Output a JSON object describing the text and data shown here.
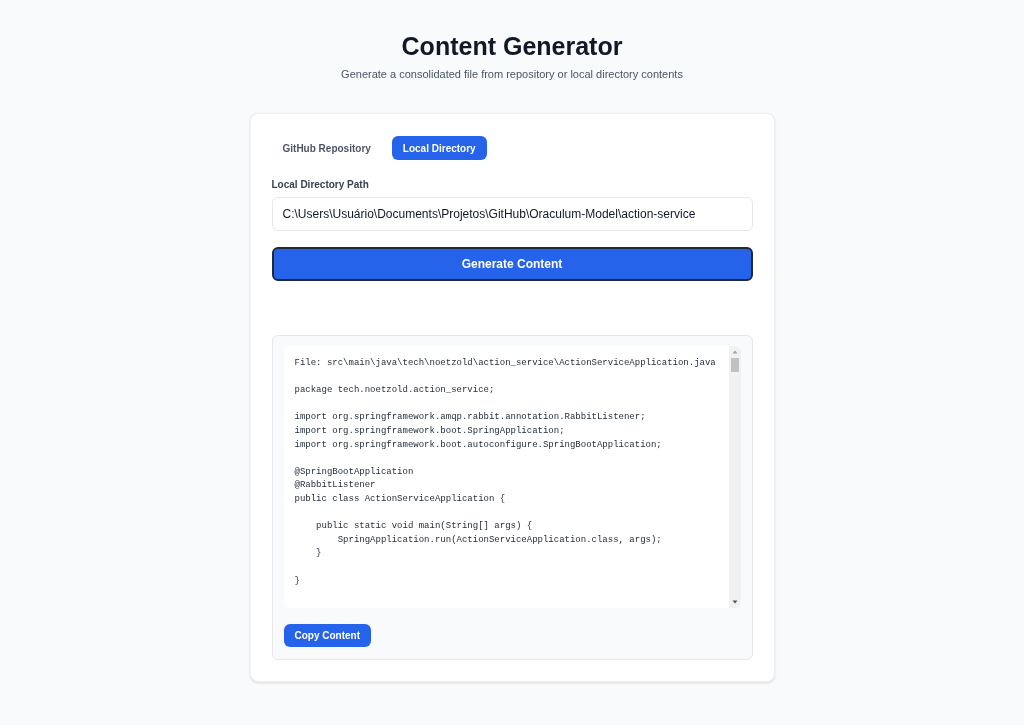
{
  "header": {
    "title": "Content Generator",
    "subtitle": "Generate a consolidated file from repository or local directory contents"
  },
  "tabs": [
    {
      "label": "GitHub Repository",
      "selected": false
    },
    {
      "label": "Local Directory",
      "selected": true
    }
  ],
  "path_field": {
    "label": "Local Directory Path",
    "value": "C:\\Users\\Usuário\\Documents\\Projetos\\GitHub\\Oraculum-Model\\action-service"
  },
  "generate_button": "Generate Content",
  "output": {
    "code_blocks": [
      [
        "File: src\\main\\java\\tech\\noetzold\\action_service\\ActionServiceApplication.java"
      ],
      [
        "package tech.noetzold.action_service;"
      ],
      [
        "import org.springframework.amqp.rabbit.annotation.RabbitListener;",
        "import org.springframework.boot.SpringApplication;",
        "import org.springframework.boot.autoconfigure.SpringBootApplication;"
      ],
      [
        "@SpringBootApplication",
        "@RabbitListener",
        "public class ActionServiceApplication {"
      ],
      [
        "    public static void main(String[] args) {",
        "        SpringApplication.run(ActionServiceApplication.class, args);",
        "    }"
      ],
      [
        "}"
      ]
    ],
    "copy_button": "Copy Content"
  }
}
